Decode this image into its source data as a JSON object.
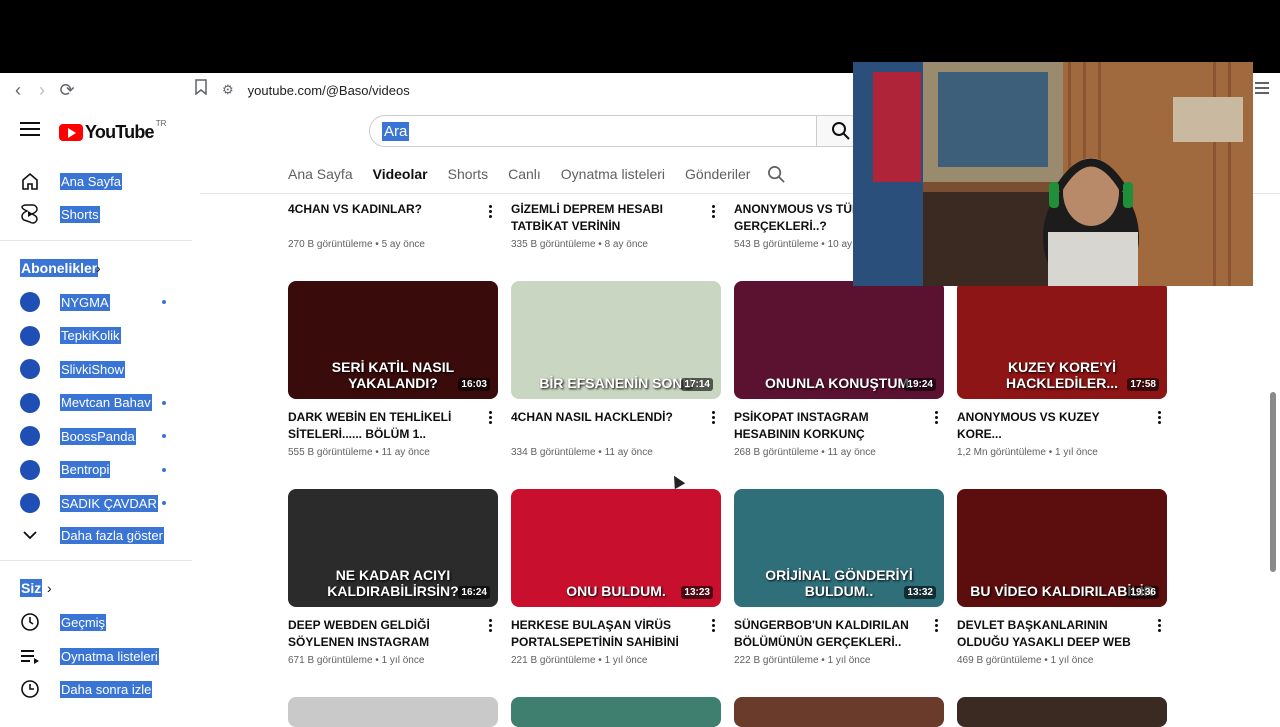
{
  "browser": {
    "url": "youtube.com/@Baso/videos"
  },
  "header": {
    "logo_text": "YouTube",
    "country_code": "TR",
    "search_placeholder": "Ara"
  },
  "sidebar": {
    "home": "Ana Sayfa",
    "shorts": "Shorts",
    "subs_title": "Abonelikler",
    "channels": [
      {
        "name": "NYGMA",
        "dot": true
      },
      {
        "name": "TepkiKolik",
        "dot": false
      },
      {
        "name": "SlivkiShow",
        "dot": false
      },
      {
        "name": "Mevtcan Bahav",
        "dot": true
      },
      {
        "name": "BoossPanda",
        "dot": true
      },
      {
        "name": "Bentropi",
        "dot": true
      },
      {
        "name": "SADIK ÇAVDAR",
        "dot": true
      }
    ],
    "show_more": "Daha fazla göster",
    "you_title": "Siz",
    "history": "Geçmiş",
    "playlists": "Oynatma listeleri",
    "watch_later": "Daha sonra izle"
  },
  "tabs": [
    "Ana Sayfa",
    "Videolar",
    "Shorts",
    "Canlı",
    "Oynatma listeleri",
    "Gönderiler"
  ],
  "active_tab": "Videolar",
  "top_row": [
    {
      "title": "4CHAN VS KADINLAR?",
      "views": "270 B görüntüleme",
      "age": "5 ay önce"
    },
    {
      "title": "GİZEMLİ DEPREM HESABI TATBİKAT VERİNİN SAHİPLERİNİ...",
      "views": "335 B görüntüleme",
      "age": "8 ay önce"
    },
    {
      "title": "ANONYMOUS VS TÜRK GERÇEKLERİ..?",
      "views": "543 B görüntüleme",
      "age": "10 ay önce"
    }
  ],
  "videos": [
    {
      "title": "DARK WEBİN EN TEHLİKELİ SİTELERİ...... BÖLÜM 1..",
      "views": "555 B görüntüleme",
      "age": "11 ay önce",
      "duration": "16:03",
      "overlay": "SERİ KATİL NASIL YAKALANDI?",
      "bg": "#3a0b0b"
    },
    {
      "title": "4CHAN NASIL HACKLENDİ?",
      "views": "334 B görüntüleme",
      "age": "11 ay önce",
      "duration": "17:14",
      "overlay": "BİR EFSANENİN SONU",
      "bg": "#c9d6c1"
    },
    {
      "title": "PSİKOPAT INSTAGRAM HESABININ KORKUNÇ GERÇEKLERİ:...",
      "views": "268 B görüntüleme",
      "age": "11 ay önce",
      "duration": "19:24",
      "overlay": "ONUNLA KONUŞTUM.",
      "bg": "#5a1230"
    },
    {
      "title": "ANONYMOUS VS KUZEY KORE...",
      "views": "1,2 Mn görüntüleme",
      "age": "1 yıl önce",
      "duration": "17:58",
      "overlay": "KUZEY KORE'Yİ HACKLEDİLER...",
      "bg": "#8e1515"
    },
    {
      "title": "DEEP WEBDEN GELDİĞİ SÖYLENEN INSTAGRAM HESABI:...",
      "views": "671 B görüntüleme",
      "age": "1 yıl önce",
      "duration": "16:24",
      "overlay": "NE KADAR ACIYI KALDIRABİLİRSİN?",
      "bg": "#2b2b2b"
    },
    {
      "title": "HERKESE BULAŞAN VİRÜS PORTALSEPETİNİN SAHİBİNİ NAS...",
      "views": "221 B görüntüleme",
      "age": "1 yıl önce",
      "duration": "13:23",
      "overlay": "ONU BULDUM.",
      "bg": "#c8102e"
    },
    {
      "title": "SÜNGERBOB'UN KALDIRILAN BÖLÜMÜNÜN GERÇEKLERİ..",
      "views": "222 B görüntüleme",
      "age": "1 yıl önce",
      "duration": "13:32",
      "overlay": "ORİJİNAL GÖNDERİYİ BULDUM..",
      "bg": "#2f6f7a"
    },
    {
      "title": "DEVLET BAŞKANLARININ OLDUĞU YASAKLI DEEP WEB VİDEOSUNUN...",
      "views": "469 B görüntüleme",
      "age": "1 yıl önce",
      "duration": "19:36",
      "overlay": "BU VİDEO KALDIRILABİLİR",
      "bg": "#5c0d0d"
    }
  ]
}
